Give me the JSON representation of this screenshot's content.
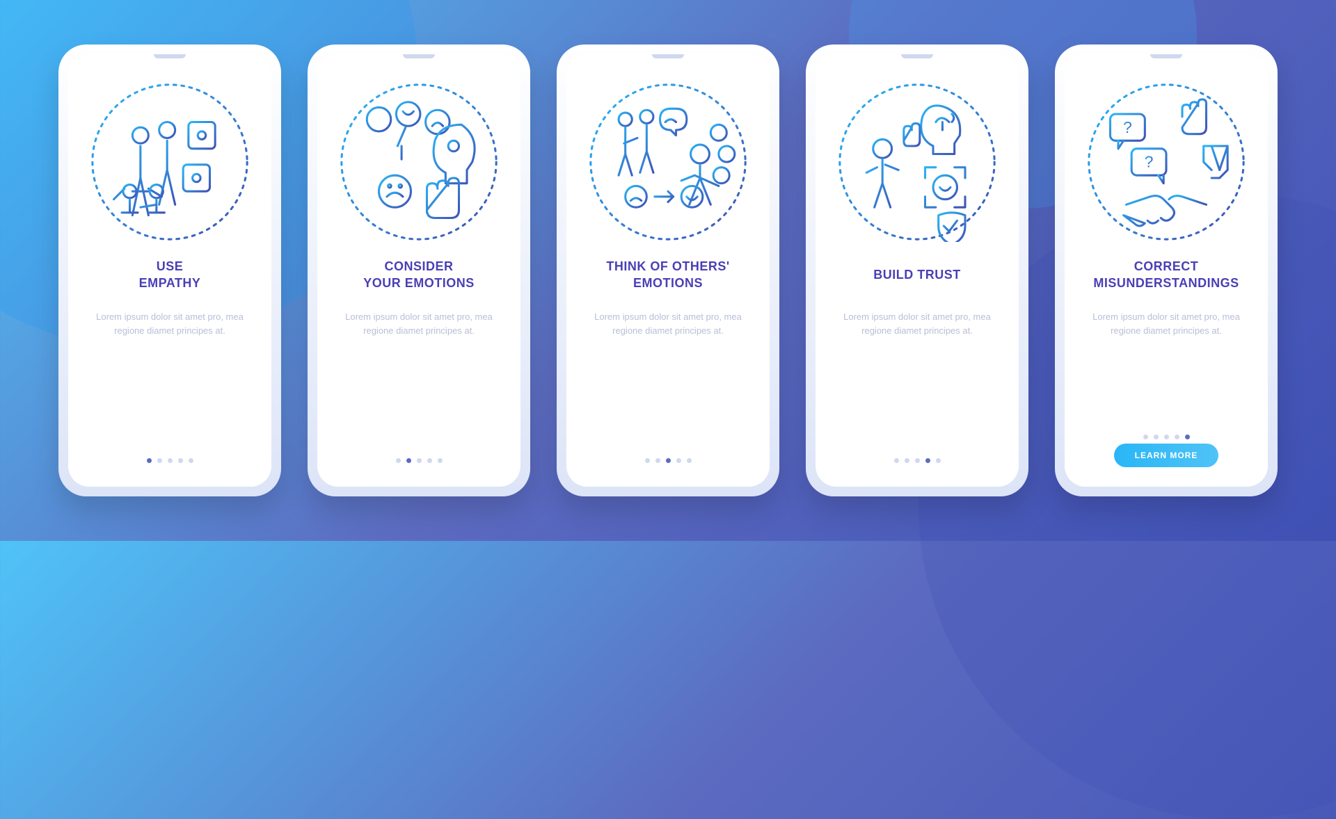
{
  "colors": {
    "background_gradient": [
      "#4fc3f7",
      "#5c6bc0",
      "#3f51b5"
    ],
    "title": "#4a3fb5",
    "body_text": "#b8bed6",
    "dot_inactive": "#cfd8ee",
    "dot_active": "#5c6bc0",
    "cta_gradient": [
      "#29b6f6",
      "#4fc3f7"
    ],
    "icon_gradient": [
      "#29b6f6",
      "#3f51b5"
    ]
  },
  "screens": [
    {
      "icon": "use-empathy-icon",
      "title": "USE\nEMPATHY",
      "body": "Lorem ipsum dolor sit amet pro, mea regione diamet principes at.",
      "active_dot": 0
    },
    {
      "icon": "consider-emotions-icon",
      "title": "CONSIDER\nYOUR EMOTIONS",
      "body": "Lorem ipsum dolor sit amet pro, mea regione diamet principes at.",
      "active_dot": 1
    },
    {
      "icon": "others-emotions-icon",
      "title": "THINK OF OTHERS'\nEMOTIONS",
      "body": "Lorem ipsum dolor sit amet pro, mea regione diamet principes at.",
      "active_dot": 2
    },
    {
      "icon": "build-trust-icon",
      "title": "BUILD TRUST",
      "body": "Lorem ipsum dolor sit amet pro, mea regione diamet principes at.",
      "active_dot": 3
    },
    {
      "icon": "correct-misunderstandings-icon",
      "title": "CORRECT\nMISUNDERSTANDINGS",
      "body": "Lorem ipsum dolor sit amet pro, mea regione diamet principes at.",
      "active_dot": 4
    }
  ],
  "total_dots": 5,
  "cta_label": "LEARN MORE"
}
